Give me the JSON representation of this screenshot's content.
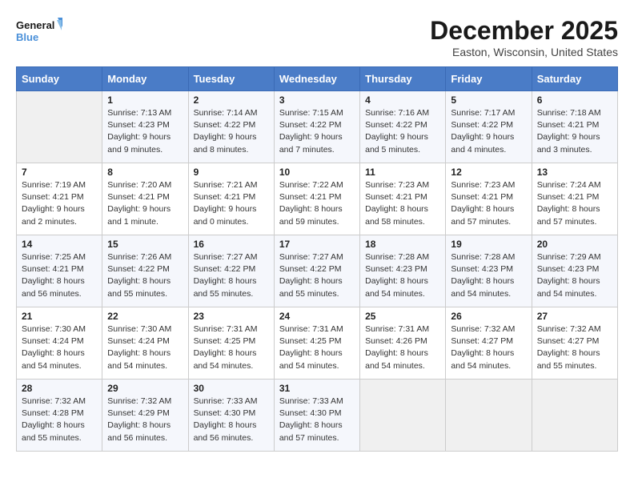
{
  "logo": {
    "line1": "General",
    "line2": "Blue"
  },
  "title": "December 2025",
  "subtitle": "Easton, Wisconsin, United States",
  "days_of_week": [
    "Sunday",
    "Monday",
    "Tuesday",
    "Wednesday",
    "Thursday",
    "Friday",
    "Saturday"
  ],
  "weeks": [
    [
      {
        "day": "",
        "info": ""
      },
      {
        "day": "1",
        "info": "Sunrise: 7:13 AM\nSunset: 4:23 PM\nDaylight: 9 hours\nand 9 minutes."
      },
      {
        "day": "2",
        "info": "Sunrise: 7:14 AM\nSunset: 4:22 PM\nDaylight: 9 hours\nand 8 minutes."
      },
      {
        "day": "3",
        "info": "Sunrise: 7:15 AM\nSunset: 4:22 PM\nDaylight: 9 hours\nand 7 minutes."
      },
      {
        "day": "4",
        "info": "Sunrise: 7:16 AM\nSunset: 4:22 PM\nDaylight: 9 hours\nand 5 minutes."
      },
      {
        "day": "5",
        "info": "Sunrise: 7:17 AM\nSunset: 4:22 PM\nDaylight: 9 hours\nand 4 minutes."
      },
      {
        "day": "6",
        "info": "Sunrise: 7:18 AM\nSunset: 4:21 PM\nDaylight: 9 hours\nand 3 minutes."
      }
    ],
    [
      {
        "day": "7",
        "info": "Sunrise: 7:19 AM\nSunset: 4:21 PM\nDaylight: 9 hours\nand 2 minutes."
      },
      {
        "day": "8",
        "info": "Sunrise: 7:20 AM\nSunset: 4:21 PM\nDaylight: 9 hours\nand 1 minute."
      },
      {
        "day": "9",
        "info": "Sunrise: 7:21 AM\nSunset: 4:21 PM\nDaylight: 9 hours\nand 0 minutes."
      },
      {
        "day": "10",
        "info": "Sunrise: 7:22 AM\nSunset: 4:21 PM\nDaylight: 8 hours\nand 59 minutes."
      },
      {
        "day": "11",
        "info": "Sunrise: 7:23 AM\nSunset: 4:21 PM\nDaylight: 8 hours\nand 58 minutes."
      },
      {
        "day": "12",
        "info": "Sunrise: 7:23 AM\nSunset: 4:21 PM\nDaylight: 8 hours\nand 57 minutes."
      },
      {
        "day": "13",
        "info": "Sunrise: 7:24 AM\nSunset: 4:21 PM\nDaylight: 8 hours\nand 57 minutes."
      }
    ],
    [
      {
        "day": "14",
        "info": "Sunrise: 7:25 AM\nSunset: 4:21 PM\nDaylight: 8 hours\nand 56 minutes."
      },
      {
        "day": "15",
        "info": "Sunrise: 7:26 AM\nSunset: 4:22 PM\nDaylight: 8 hours\nand 55 minutes."
      },
      {
        "day": "16",
        "info": "Sunrise: 7:27 AM\nSunset: 4:22 PM\nDaylight: 8 hours\nand 55 minutes."
      },
      {
        "day": "17",
        "info": "Sunrise: 7:27 AM\nSunset: 4:22 PM\nDaylight: 8 hours\nand 55 minutes."
      },
      {
        "day": "18",
        "info": "Sunrise: 7:28 AM\nSunset: 4:23 PM\nDaylight: 8 hours\nand 54 minutes."
      },
      {
        "day": "19",
        "info": "Sunrise: 7:28 AM\nSunset: 4:23 PM\nDaylight: 8 hours\nand 54 minutes."
      },
      {
        "day": "20",
        "info": "Sunrise: 7:29 AM\nSunset: 4:23 PM\nDaylight: 8 hours\nand 54 minutes."
      }
    ],
    [
      {
        "day": "21",
        "info": "Sunrise: 7:30 AM\nSunset: 4:24 PM\nDaylight: 8 hours\nand 54 minutes."
      },
      {
        "day": "22",
        "info": "Sunrise: 7:30 AM\nSunset: 4:24 PM\nDaylight: 8 hours\nand 54 minutes."
      },
      {
        "day": "23",
        "info": "Sunrise: 7:31 AM\nSunset: 4:25 PM\nDaylight: 8 hours\nand 54 minutes."
      },
      {
        "day": "24",
        "info": "Sunrise: 7:31 AM\nSunset: 4:25 PM\nDaylight: 8 hours\nand 54 minutes."
      },
      {
        "day": "25",
        "info": "Sunrise: 7:31 AM\nSunset: 4:26 PM\nDaylight: 8 hours\nand 54 minutes."
      },
      {
        "day": "26",
        "info": "Sunrise: 7:32 AM\nSunset: 4:27 PM\nDaylight: 8 hours\nand 54 minutes."
      },
      {
        "day": "27",
        "info": "Sunrise: 7:32 AM\nSunset: 4:27 PM\nDaylight: 8 hours\nand 55 minutes."
      }
    ],
    [
      {
        "day": "28",
        "info": "Sunrise: 7:32 AM\nSunset: 4:28 PM\nDaylight: 8 hours\nand 55 minutes."
      },
      {
        "day": "29",
        "info": "Sunrise: 7:32 AM\nSunset: 4:29 PM\nDaylight: 8 hours\nand 56 minutes."
      },
      {
        "day": "30",
        "info": "Sunrise: 7:33 AM\nSunset: 4:30 PM\nDaylight: 8 hours\nand 56 minutes."
      },
      {
        "day": "31",
        "info": "Sunrise: 7:33 AM\nSunset: 4:30 PM\nDaylight: 8 hours\nand 57 minutes."
      },
      {
        "day": "",
        "info": ""
      },
      {
        "day": "",
        "info": ""
      },
      {
        "day": "",
        "info": ""
      }
    ]
  ]
}
